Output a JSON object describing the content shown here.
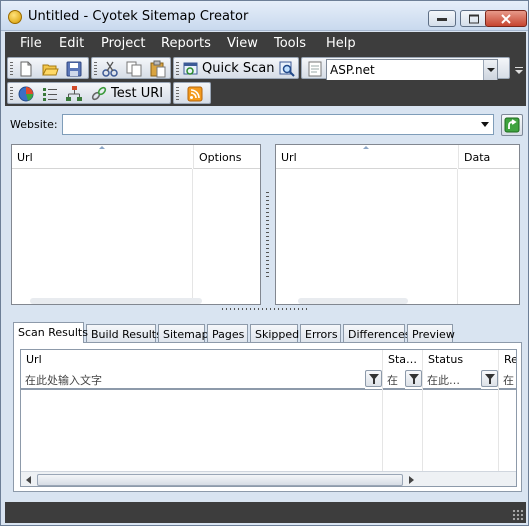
{
  "window": {
    "title": "Untitled - Cyotek Sitemap Creator"
  },
  "menu": [
    "File",
    "Edit",
    "Project",
    "Reports",
    "View",
    "Tools",
    "Help"
  ],
  "toolbar": {
    "quick_scan_label": "Quick Scan",
    "engine_selected": "ASP.net",
    "test_uri_label": "Test URI",
    "icons": [
      "new-icon",
      "open-icon",
      "save-icon",
      "cut-icon",
      "copy-icon",
      "paste-icon",
      "quick-scan-icon",
      "find-icon",
      "page-icon",
      "pie-chart-icon",
      "list-icon",
      "hierarchy-icon",
      "link-icon",
      "rss-icon"
    ]
  },
  "website": {
    "label": "Website:",
    "value": ""
  },
  "left_list": {
    "columns": [
      "Url",
      "Options"
    ]
  },
  "right_list": {
    "columns": [
      "Url",
      "Data"
    ]
  },
  "tabs": [
    "Scan Results",
    "Build Results",
    "Sitemap",
    "Pages",
    "Skipped",
    "Errors",
    "Differences",
    "Preview"
  ],
  "active_tab": "Scan Results",
  "results_grid": {
    "columns": [
      "Url",
      "Sta…",
      "Status",
      "Re"
    ],
    "filters": [
      "在此处输入文字",
      "在",
      "在此…",
      "在"
    ]
  },
  "colors": {
    "chrome_dark": "#3d3d3d",
    "window_bg": "#d9e4f1",
    "close_button": "#c64530"
  }
}
